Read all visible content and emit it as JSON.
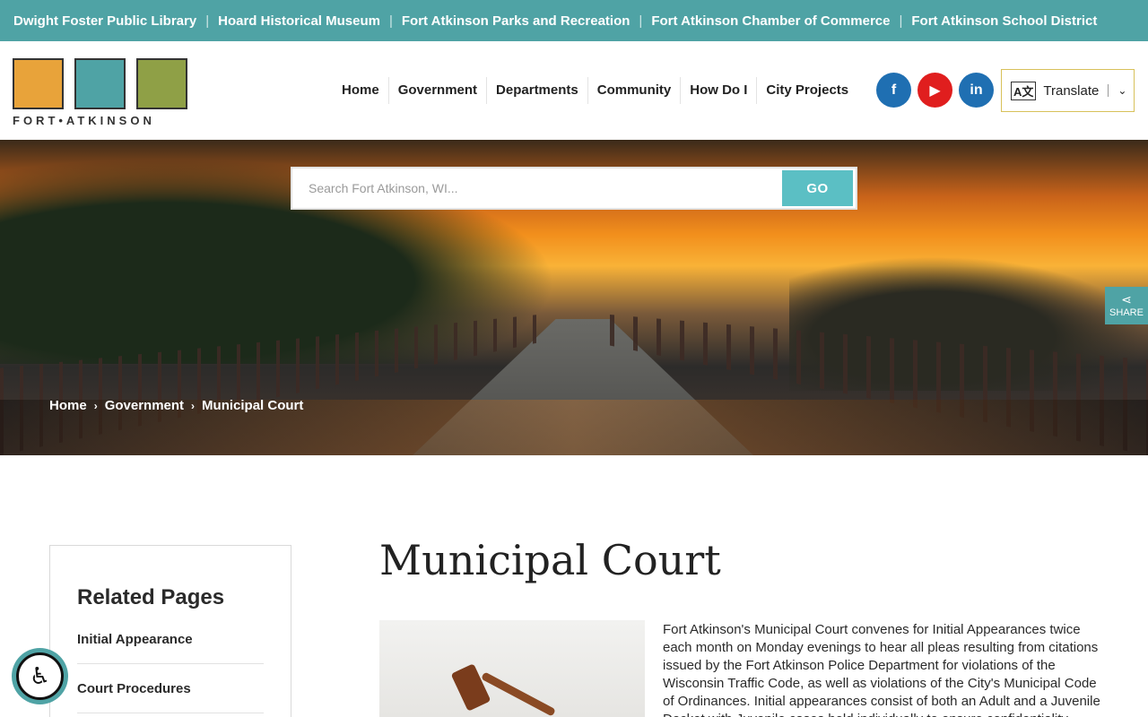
{
  "topbar": {
    "links": [
      "Dwight Foster Public Library",
      "Hoard Historical Museum",
      "Fort Atkinson Parks and Recreation",
      "Fort Atkinson Chamber of Commerce",
      "Fort Atkinson School District"
    ],
    "separator": "|"
  },
  "logo": {
    "text": "FORT•ATKINSON"
  },
  "nav": {
    "items": [
      "Home",
      "Government",
      "Departments",
      "Community",
      "How Do I",
      "City Projects"
    ]
  },
  "social": {
    "facebook_glyph": "f",
    "youtube_glyph": "▶",
    "linkedin_glyph": "in"
  },
  "translate": {
    "label": "Translate",
    "icon_glyph": "A文",
    "chevron": "⌄"
  },
  "search": {
    "placeholder": "Search Fort Atkinson, WI...",
    "button": "GO"
  },
  "breadcrumb": {
    "items": [
      "Home",
      "Government",
      "Municipal Court"
    ],
    "separator": "›"
  },
  "share": {
    "label": "SHARE",
    "glyph": "⋖"
  },
  "sidebar": {
    "title": "Related Pages",
    "links": [
      "Initial Appearance",
      "Court Procedures"
    ]
  },
  "page": {
    "title": "Municipal Court",
    "body": "Fort Atkinson's Municipal Court convenes for Initial Appearances twice each month on Monday evenings to hear all pleas resulting from citations issued by the Fort Atkinson Police Department for violations of the Wisconsin Traffic Code, as well as violations of the City's Municipal Code of Ordinances. Initial appearances consist of both an Adult and a Juvenile Docket with Juvenile cases held individually to ensure confidentiality."
  },
  "accessibility": {
    "glyph": "♿"
  },
  "colors": {
    "teal": "#4fa3a5",
    "go_button": "#5bbfc4",
    "facebook": "#1f6fb2",
    "youtube": "#e01e1e",
    "translate_border": "#d8c15a"
  }
}
